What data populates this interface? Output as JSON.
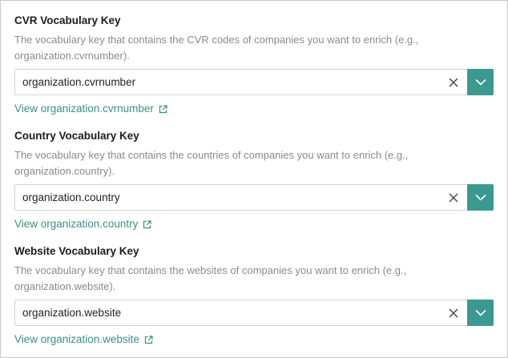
{
  "colors": {
    "accent": "#3a9a8f",
    "link": "#3a8f86",
    "description": "#8a8a8a"
  },
  "fields": [
    {
      "title": "CVR Vocabulary Key",
      "description": "The vocabulary key that contains the CVR codes of companies you want to enrich (e.g., organization.cvrnumber).",
      "value": "organization.cvrnumber",
      "link": "View organization.cvrnumber"
    },
    {
      "title": "Country Vocabulary Key",
      "description": "The vocabulary key that contains the countries of companies you want to enrich (e.g., organization.country).",
      "value": "organization.country",
      "link": "View organization.country"
    },
    {
      "title": "Website Vocabulary Key",
      "description": "The vocabulary key that contains the websites of companies you want to enrich (e.g., organization.website).",
      "value": "organization.website",
      "link": "View organization.website"
    }
  ],
  "icons": {
    "clear": "close-icon",
    "toggle": "chevron-down-icon",
    "external": "external-link-icon"
  }
}
